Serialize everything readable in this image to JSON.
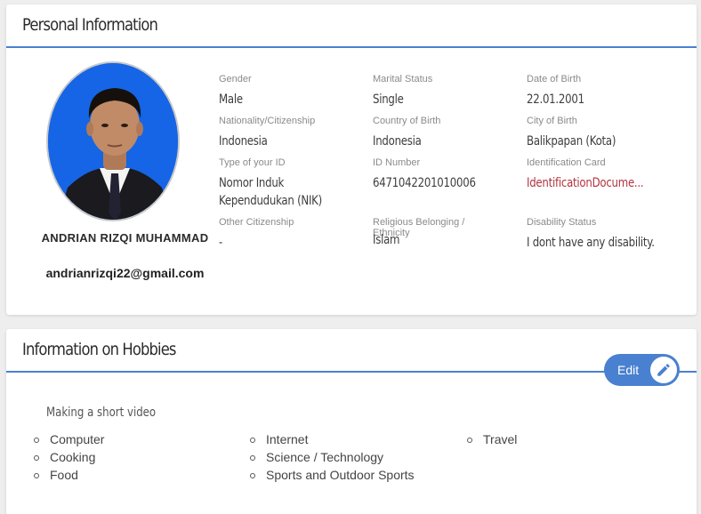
{
  "personal": {
    "title": "Personal Information",
    "profile": {
      "name": "ANDRIAN RIZQI MUHAMMAD",
      "email": "andrianrizqi22@gmail.com",
      "photo_background": "#1565e6"
    },
    "fields": [
      {
        "label": "Gender",
        "value": "Male"
      },
      {
        "label": "Marital Status",
        "value": "Single"
      },
      {
        "label": "Date of Birth",
        "value": "22.01.2001"
      },
      {
        "label": "Nationality/Citizenship",
        "value": "Indonesia"
      },
      {
        "label": "Country of Birth",
        "value": "Indonesia"
      },
      {
        "label": "City of Birth",
        "value": "Balikpapan (Kota)"
      },
      {
        "label": "Type of your ID",
        "value": "Nomor Induk Kependudukan (NIK)",
        "value_line1": "Nomor Induk",
        "value_line2": "Kependudukan (NIK)"
      },
      {
        "label": "ID Number",
        "value": "6471042201010006"
      },
      {
        "label": "Identification Card",
        "value": "IdentificationDocume..."
      },
      {
        "label": "Other Citizenship",
        "value": "-"
      },
      {
        "label": "Religious Belonging / Ethnicity",
        "value": "Islam"
      },
      {
        "label": "Disability Status",
        "value": "I dont have any disability."
      }
    ]
  },
  "hobbies": {
    "title": "Information on Hobbies",
    "edit_label": "Edit",
    "heading": "Making a short video",
    "columns": [
      [
        "Computer",
        "Cooking",
        "Food"
      ],
      [
        "Internet",
        "Science / Technology",
        "Sports and Outdoor Sports"
      ],
      [
        "Travel"
      ]
    ]
  },
  "colors": {
    "accent": "#4a80d0",
    "link": "#b3343f",
    "background": "#eeeeee"
  }
}
